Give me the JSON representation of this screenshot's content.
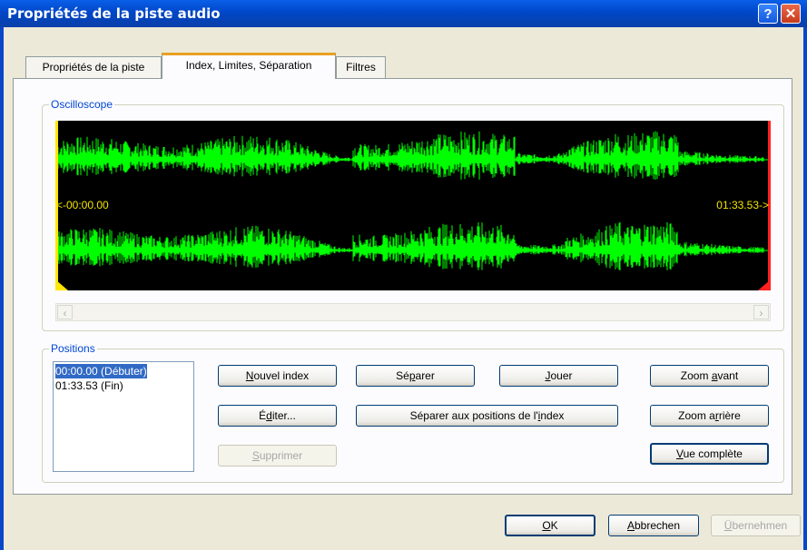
{
  "window": {
    "title": "Propriétés de la piste audio",
    "help_label": "?",
    "close_label": "✕"
  },
  "tabs": [
    {
      "label": "Propriétés de la piste",
      "active": false
    },
    {
      "label": "Index, Limites, Séparation",
      "active": true
    },
    {
      "label": "Filtres",
      "active": false
    }
  ],
  "oscilloscope": {
    "label": "Oscilloscope",
    "start_time": "<-00:00.00",
    "end_time": "01:33.53->",
    "wave_color": "#00ff00",
    "start_marker_color": "#ffe600",
    "end_marker_color": "#ff2020"
  },
  "positions": {
    "label": "Positions",
    "items": [
      {
        "label": "00:00.00 (Débuter)",
        "selected": true
      },
      {
        "label": "01:33.53 (Fin)",
        "selected": false
      }
    ]
  },
  "buttons": {
    "nouvel_index": {
      "pre": "",
      "u": "N",
      "post": "ouvel index"
    },
    "editer": {
      "pre": "É",
      "u": "d",
      "post": "iter..."
    },
    "supprimer": {
      "pre": "",
      "u": "S",
      "post": "upprimer"
    },
    "separer": {
      "pre": "Sé",
      "u": "p",
      "post": "arer"
    },
    "separer_index": {
      "pre": "Séparer aux positions de l'",
      "u": "i",
      "post": "ndex"
    },
    "jouer": {
      "pre": "",
      "u": "J",
      "post": "ouer"
    },
    "zoom_avant": {
      "pre": "Zoom ",
      "u": "a",
      "post": "vant"
    },
    "zoom_arriere": {
      "pre": "Zoom a",
      "u": "r",
      "post": "rière"
    },
    "vue_complete": {
      "pre": "",
      "u": "V",
      "post": "ue complète"
    },
    "ok": {
      "pre": "",
      "u": "O",
      "post": "K"
    },
    "abbrechen": {
      "pre": "",
      "u": "A",
      "post": "bbrechen"
    },
    "ubernehmen": {
      "pre": "",
      "u": "Ü",
      "post": "bernehmen"
    }
  },
  "scroll_icons": {
    "left": "chevron-left-icon",
    "right": "chevron-right-icon",
    "up": "chevron-up-icon",
    "down": "chevron-down-icon"
  }
}
